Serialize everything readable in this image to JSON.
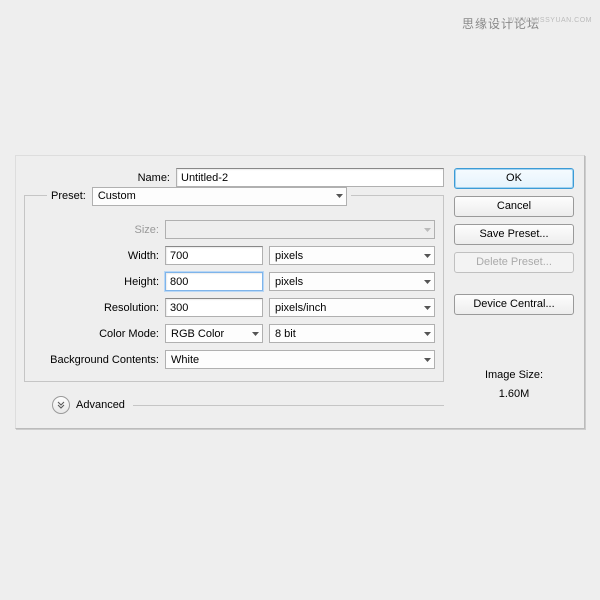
{
  "watermark": {
    "text": "思缘设计论坛",
    "url": "WWW.MISSYUAN.COM"
  },
  "labels": {
    "name": "Name:",
    "preset": "Preset:",
    "size": "Size:",
    "width": "Width:",
    "height": "Height:",
    "resolution": "Resolution:",
    "colorMode": "Color Mode:",
    "bgContents": "Background Contents:",
    "advanced": "Advanced",
    "imageSize": "Image Size:"
  },
  "values": {
    "name": "Untitled-2",
    "preset": "Custom",
    "size": "",
    "width": "700",
    "height": "800",
    "resolution": "300",
    "colorMode": "RGB Color",
    "bitDepth": "8 bit",
    "bgContents": "White",
    "imageSize": "1.60M"
  },
  "units": {
    "width": "pixels",
    "height": "pixels",
    "resolution": "pixels/inch"
  },
  "buttons": {
    "ok": "OK",
    "cancel": "Cancel",
    "savePreset": "Save Preset...",
    "deletePreset": "Delete Preset...",
    "deviceCentral": "Device Central..."
  }
}
